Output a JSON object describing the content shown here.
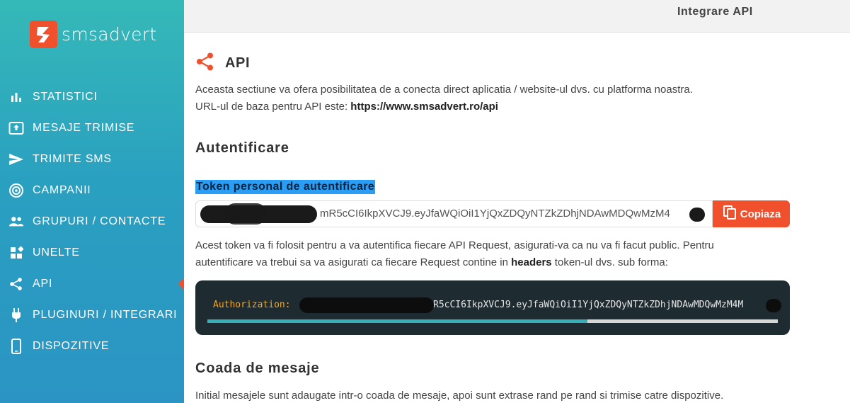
{
  "brand": {
    "name": "smsadvert",
    "accent": "#f0502c"
  },
  "nav": {
    "items": [
      {
        "label": "STATISTICI",
        "icon": "bar-chart-icon"
      },
      {
        "label": "MESAJE TRIMISE",
        "icon": "outbox-icon"
      },
      {
        "label": "TRIMITE SMS",
        "icon": "send-icon"
      },
      {
        "label": "CAMPANII",
        "icon": "campaign-icon"
      },
      {
        "label": "GRUPURI / CONTACTE",
        "icon": "people-icon"
      },
      {
        "label": "UNELTE",
        "icon": "widgets-icon"
      },
      {
        "label": "API",
        "icon": "share-icon",
        "active": true
      },
      {
        "label": "PLUGINURI / INTEGRARI",
        "icon": "plug-icon"
      },
      {
        "label": "DISPOZITIVE",
        "icon": "phone-icon"
      }
    ]
  },
  "header": {
    "title": "Integrare API"
  },
  "api": {
    "title": "API",
    "intro_line1": "Aceasta sectiune va ofera posibilitatea de a conecta direct aplicatia / website-ul dvs. cu platforma noastra.",
    "intro_line2_prefix": "URL-ul de baza pentru API este: ",
    "base_url": "https://www.smsadvert.ro/api"
  },
  "auth": {
    "title": "Autentificare",
    "token_label": "Token personal de autentificare",
    "token_value": "mR5cCI6IkpXVCJ9.eyJfaWQiOiI1YjQxZDQyNTZkZDhjNDAwMDQwMzM4",
    "copy_label": "Copiaza",
    "desc_line1": "Acest token va fi folosit pentru a va autentifica fiecare API Request, asigurati-va ca nu va fi facut public. Pentru",
    "desc_line2_prefix": "autentificare va trebui sa va asigurati ca fiecare Request contine in ",
    "desc_headers": "headers",
    "desc_line2_suffix": " token-ul dvs. sub forma:",
    "code_key": "Authorization:",
    "code_value": "R5cCI6IkpXVCJ9.eyJfaWQiOiI1YjQxZDQyNTZkZDhjNDAwMDQwMzM4M"
  },
  "queue": {
    "title": "Coada de mesaje",
    "desc": "Initial mesajele sunt adaugate intr-o coada de mesaje, apoi sunt extrase rand pe rand si trimise catre dispozitive."
  }
}
